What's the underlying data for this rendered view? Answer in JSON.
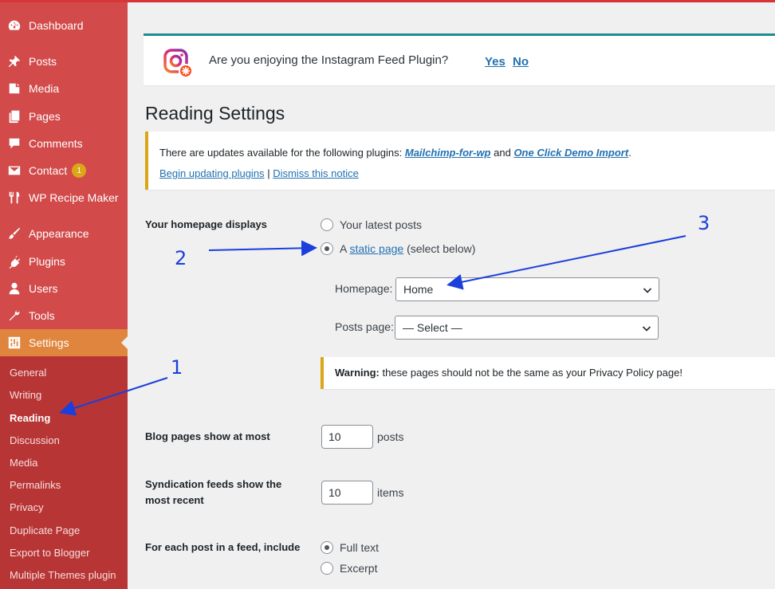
{
  "sidebar": {
    "items": [
      {
        "label": "Dashboard",
        "icon": "dashboard-icon"
      },
      {
        "label": "Posts",
        "icon": "pin-icon"
      },
      {
        "label": "Media",
        "icon": "media-icon"
      },
      {
        "label": "Pages",
        "icon": "pages-icon"
      },
      {
        "label": "Comments",
        "icon": "comments-icon"
      },
      {
        "label": "Contact",
        "icon": "mail-icon",
        "badge": "1"
      },
      {
        "label": "WP Recipe Maker",
        "icon": "utensils-icon"
      },
      {
        "label": "Appearance",
        "icon": "paintbrush-icon"
      },
      {
        "label": "Plugins",
        "icon": "plugins-icon"
      },
      {
        "label": "Users",
        "icon": "users-icon"
      },
      {
        "label": "Tools",
        "icon": "tools-icon"
      },
      {
        "label": "Settings",
        "icon": "settings-icon",
        "active": true
      }
    ],
    "submenu": [
      "General",
      "Writing",
      "Reading",
      "Discussion",
      "Media",
      "Permalinks",
      "Privacy",
      "Duplicate Page",
      "Export to Blogger",
      "Multiple Themes plugin"
    ],
    "current_submenu": "Reading"
  },
  "ig_notice": {
    "text": "Are you enjoying the Instagram Feed Plugin?",
    "yes": "Yes",
    "no": "No"
  },
  "page_title": "Reading Settings",
  "update_notice": {
    "prefix": "There are updates available for the following plugins:",
    "plugin1": "Mailchimp-for-wp",
    "and": "and",
    "plugin2": "One Click Demo Import",
    "suffix": ".",
    "begin_link": "Begin updating plugins",
    "separator": "|",
    "dismiss_link": "Dismiss this notice"
  },
  "homepage_displays": {
    "label": "Your homepage displays",
    "option_latest": "Your latest posts",
    "option_static_prefix": "A",
    "option_static_link": "static page",
    "option_static_suffix": "(select below)",
    "selected": "static",
    "homepage_label": "Homepage:",
    "homepage_value": "Home",
    "posts_page_label": "Posts page:",
    "posts_page_value": "— Select —",
    "warning_bold": "Warning:",
    "warning_text": "these pages should not be the same as your Privacy Policy page!"
  },
  "blog_pages": {
    "label": "Blog pages show at most",
    "value": "10",
    "unit": "posts"
  },
  "syndication": {
    "label_line1": "Syndication feeds show the",
    "label_line2": "most recent",
    "value": "10",
    "unit": "items"
  },
  "feed_include": {
    "label": "For each post in a feed, include",
    "option_full": "Full text",
    "option_excerpt": "Excerpt",
    "selected": "full"
  },
  "annotations": {
    "one": "1",
    "two": "2",
    "three": "3",
    "color": "#1a3fdc"
  },
  "colors": {
    "sidebar": "#d24a4a",
    "submenu": "#b83535",
    "active": "#e0853d",
    "link": "#2271b1",
    "notice_border": "#dba617"
  }
}
